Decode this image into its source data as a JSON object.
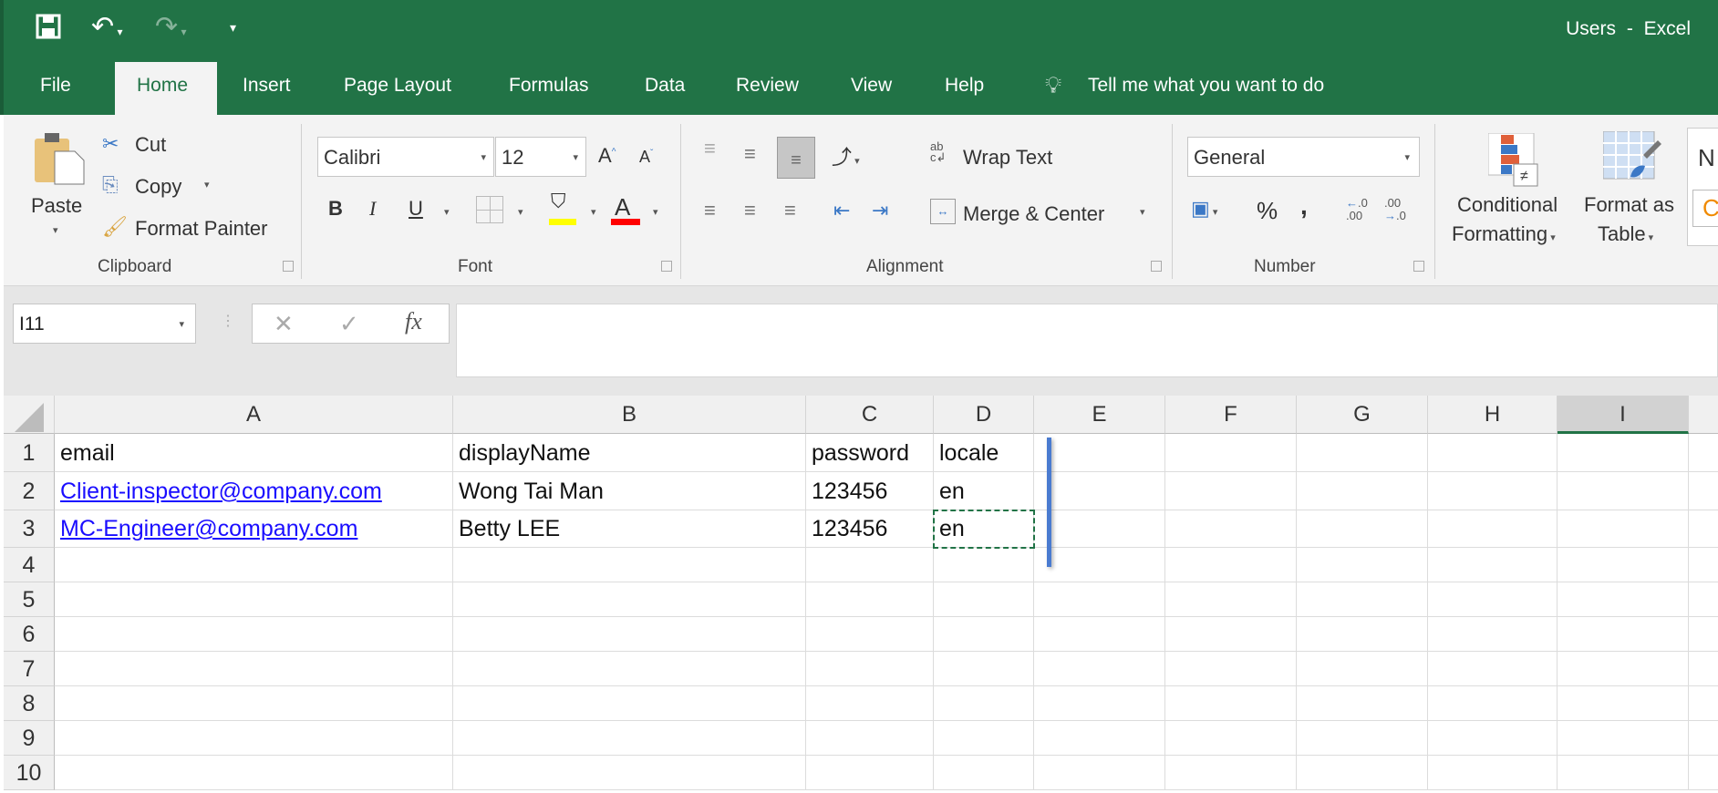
{
  "window": {
    "title": "Users  -  Excel"
  },
  "qat": {
    "save_icon": "save-icon",
    "undo_icon": "undo-icon",
    "redo_icon": "redo-icon",
    "customize_icon": "customize-qat-icon"
  },
  "tabs": [
    "File",
    "Home",
    "Insert",
    "Page Layout",
    "Formulas",
    "Data",
    "Review",
    "View",
    "Help"
  ],
  "tell_me": "Tell me what you want to do",
  "ribbon": {
    "clipboard": {
      "label": "Clipboard",
      "paste": "Paste",
      "cut": "Cut",
      "copy": "Copy",
      "format_painter": "Format Painter"
    },
    "font": {
      "label": "Font",
      "name": "Calibri",
      "size": "12",
      "bold": "B",
      "italic": "I",
      "underline": "U",
      "font_color": "A",
      "highlight_color": "#ffff00",
      "text_color": "#ff0000"
    },
    "alignment": {
      "label": "Alignment",
      "wrap_text": "Wrap Text",
      "merge_center": "Merge & Center"
    },
    "number": {
      "label": "Number",
      "format": "General",
      "percent": "%",
      "comma": ","
    },
    "styles": {
      "conditional_1": "Conditional",
      "conditional_2": "Formatting",
      "format_table_1": "Format as",
      "format_table_2": "Table",
      "normal": "N",
      "check": "C"
    }
  },
  "formula_bar": {
    "name_box": "I11",
    "cancel": "✕",
    "enter": "✓",
    "fx": "fx",
    "value": ""
  },
  "sheet": {
    "columns": [
      "A",
      "B",
      "C",
      "D",
      "E",
      "F",
      "G",
      "H",
      "I"
    ],
    "selected_column": "I",
    "row_numbers": [
      "1",
      "2",
      "3",
      "4",
      "5",
      "6",
      "7",
      "8",
      "9",
      "10"
    ],
    "rows": [
      [
        "email",
        "displayName",
        "password",
        "locale"
      ],
      [
        "Client-inspector@company.com",
        "Wong Tai Man",
        "123456",
        "en"
      ],
      [
        "MC-Engineer@company.com",
        "Betty LEE",
        "123456",
        "en"
      ]
    ],
    "link_color": "#1a0dff",
    "accent": "#217346"
  }
}
